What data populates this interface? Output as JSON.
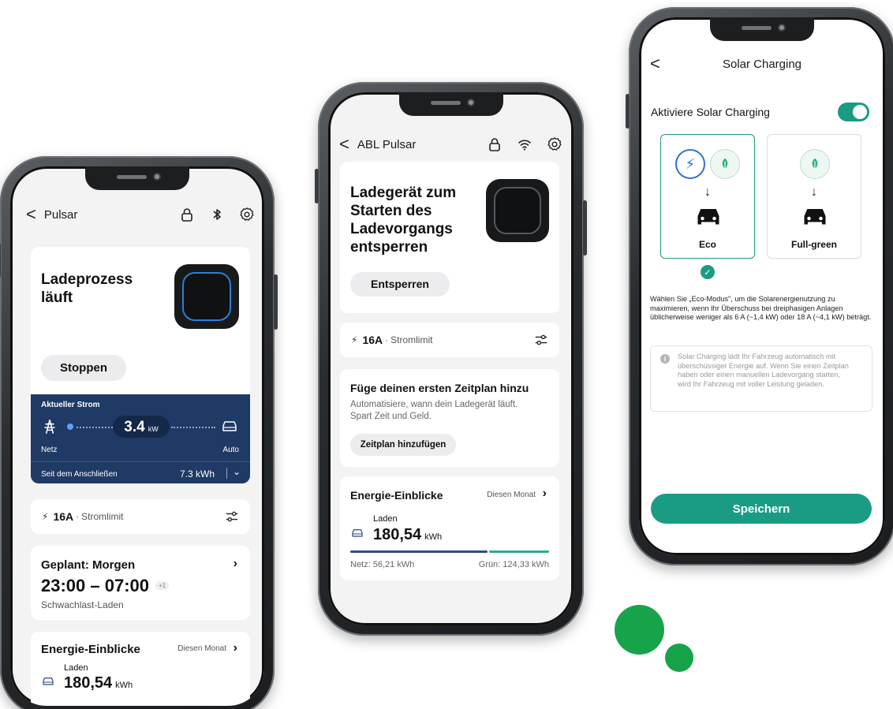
{
  "phone1": {
    "header": {
      "back": "<",
      "title": "Pulsar"
    },
    "status_card": {
      "title": "Ladeprozess läuft",
      "stop_button": "Stoppen",
      "current": {
        "label": "Aktueller Strom",
        "value": "3.4",
        "unit": "kW",
        "source_label": "Netz",
        "target_label": "Auto",
        "since_label": "Seit dem Anschließen",
        "since_value": "7.3 kWh"
      }
    },
    "limit": {
      "amps": "16A",
      "sep": "·",
      "label": "Stromlimit"
    },
    "schedule": {
      "title": "Geplant: Morgen",
      "time": "23:00 – 07:00",
      "badge": "+1",
      "subtitle": "Schwachlast-Laden"
    },
    "insights": {
      "title": "Energie-Einblicke",
      "period": "Diesen Monat",
      "charging_label": "Laden",
      "value": "180,54",
      "unit": "kWh"
    }
  },
  "phone2": {
    "header": {
      "back": "<",
      "title": "ABL Pulsar"
    },
    "unlock_card": {
      "title": "Ladegerät zum Starten des Ladevorgangs entsperren",
      "unlock_button": "Entsperren"
    },
    "limit": {
      "amps": "16A",
      "sep": "·",
      "label": "Stromlimit"
    },
    "schedule_card": {
      "title": "Füge deinen ersten Zeitplan hinzu",
      "description": "Automatisiere, wann dein Ladegerät läuft. Spart Zeit und Geld.",
      "add_button": "Zeitplan hinzufügen"
    },
    "insights": {
      "title": "Energie-Einblicke",
      "period": "Diesen Monat",
      "charging_label": "Laden",
      "value": "180,54",
      "unit": "kWh",
      "grid": "Netz: 56,21 kWh",
      "green": "Grün: 124,33 kWh",
      "grid_share": 0.69
    }
  },
  "phone3": {
    "header": {
      "back": "<",
      "title": "Solar Charging"
    },
    "activate_label": "Aktiviere Solar Charging",
    "modes": [
      {
        "label": "Eco",
        "selected": true
      },
      {
        "label": "Full-green",
        "selected": false
      }
    ],
    "description": "Wählen Sie „Eco-Modus\", um die Solarenergienutzung zu maximieren, wenn Ihr Überschuss bei dreiphasigen Anlagen üblicherweise weniger als 6 A (~1,4 kW) oder 18 A (~4,1 kW) beträgt.",
    "info": "Solar Charging lädt Ihr Fahrzeug automatisch mit überschüssiger Energie auf. Wenn Sie einen Zeitplan haben oder einen manuellen Ladevorgang starten, wird Ihr Fahrzeug mit voller Leistung geladen.",
    "save_button": "Speichern"
  },
  "colors": {
    "accent_green": "#1a9c84",
    "panel_blue": "#1f3a64",
    "grid_bar": "#2f4a86",
    "green_bar": "#26b08a",
    "decor_green": "#17a34a"
  }
}
